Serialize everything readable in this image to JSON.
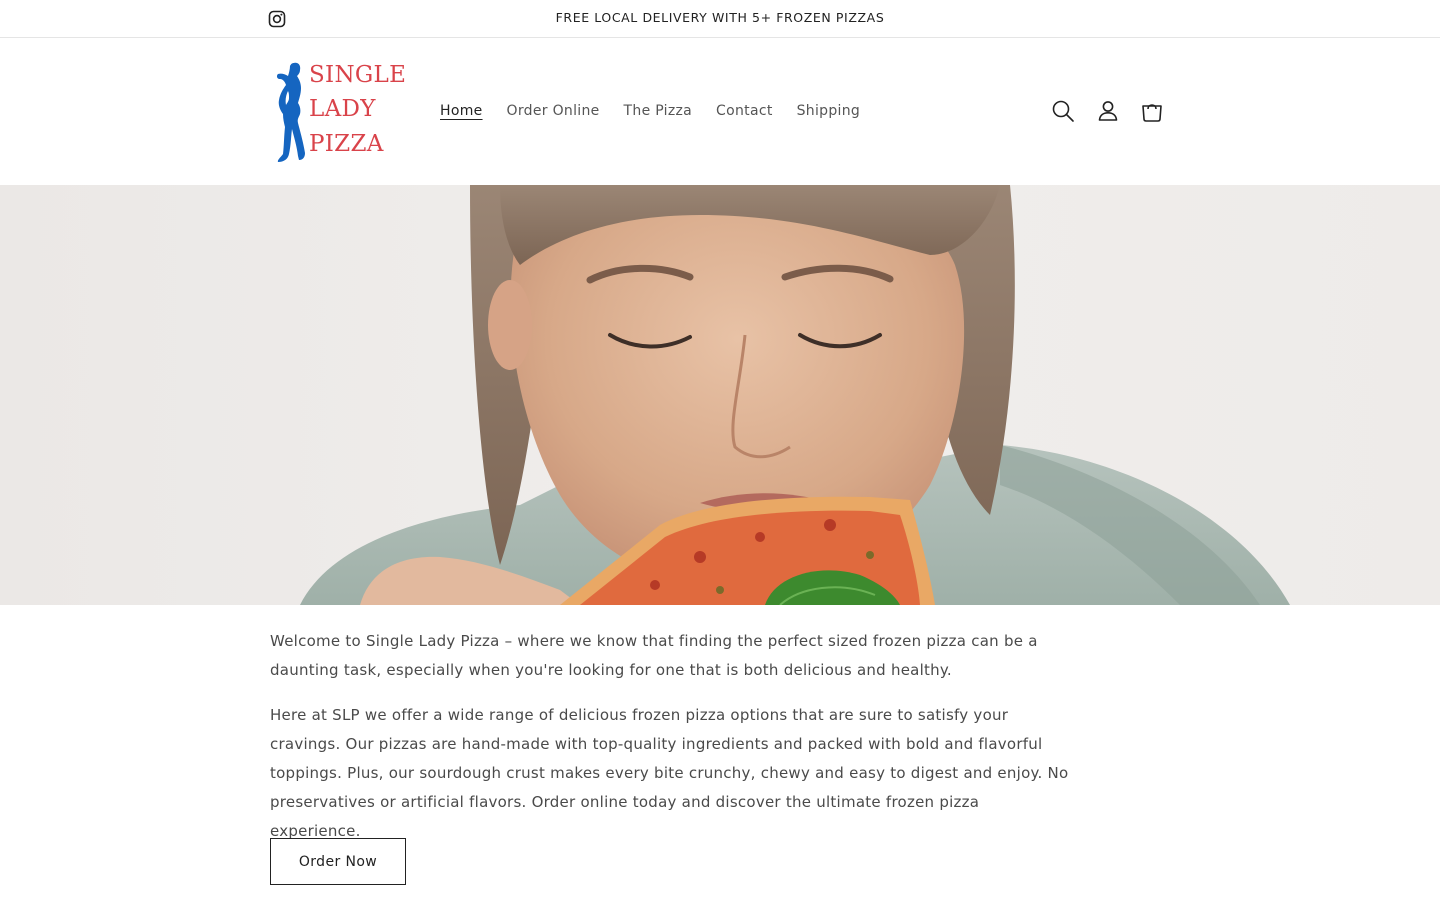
{
  "announcement": {
    "text": "FREE LOCAL DELIVERY WITH 5+ FROZEN PIZZAS",
    "social_icon": "instagram-icon"
  },
  "logo": {
    "line1": "SINGLE",
    "line2": "LADY",
    "line3": "PIZZA",
    "text_color": "#d9434a",
    "figure_color": "#1565c0"
  },
  "nav": {
    "items": [
      {
        "label": "Home",
        "active": true
      },
      {
        "label": "Order Online",
        "active": false
      },
      {
        "label": "The Pizza",
        "active": false
      },
      {
        "label": "Contact",
        "active": false
      },
      {
        "label": "Shipping",
        "active": false
      }
    ]
  },
  "header_icons": [
    "search-icon",
    "account-icon",
    "cart-icon"
  ],
  "hero": {
    "image": "woman-eating-pizza-photo"
  },
  "main": {
    "paragraph1": "Welcome to Single Lady Pizza – where we know that finding the perfect sized frozen pizza can be a daunting task, especially when you're looking for one that is both delicious and healthy.",
    "paragraph2": "Here at SLP we offer a wide range of delicious frozen pizza options that are sure to satisfy your cravings. Our pizzas are hand-made with top-quality ingredients and packed with bold and flavorful toppings. Plus, our sourdough crust makes every bite crunchy, chewy and easy to digest and enjoy. No preservatives or artificial flavors. Order online today and discover the ultimate frozen pizza experience.",
    "cta_label": "Order Now"
  }
}
